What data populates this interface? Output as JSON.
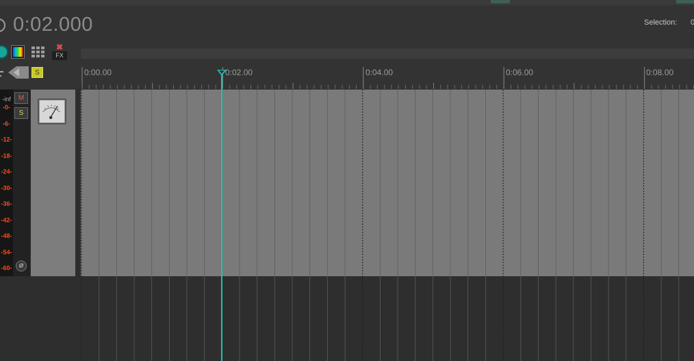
{
  "transport": {
    "time": "0:02.000",
    "selection_label": "Selection:",
    "selection_value": "0"
  },
  "toolbar": {
    "fx_label": "FX",
    "fx_x": "✖"
  },
  "ruler": {
    "labels": [
      "0:00.00",
      "0:02.00",
      "0:04.00",
      "0:06.00",
      "0:08.00"
    ],
    "solo_label": "S"
  },
  "track": {
    "meter_top": "-inf",
    "meter_scale": [
      "-0-",
      "-6-",
      "-12-",
      "-18-",
      "-24-",
      "-30-",
      "-36-",
      "-42-",
      "-48-",
      "-54-",
      "-60-"
    ],
    "mute_label": "M",
    "solo_label": "S",
    "phase_label": "⌀"
  },
  "colors": {
    "playhead": "#1cc2b2",
    "meter_scale": "#ff4a1a",
    "lane": "#7a7a7a"
  }
}
